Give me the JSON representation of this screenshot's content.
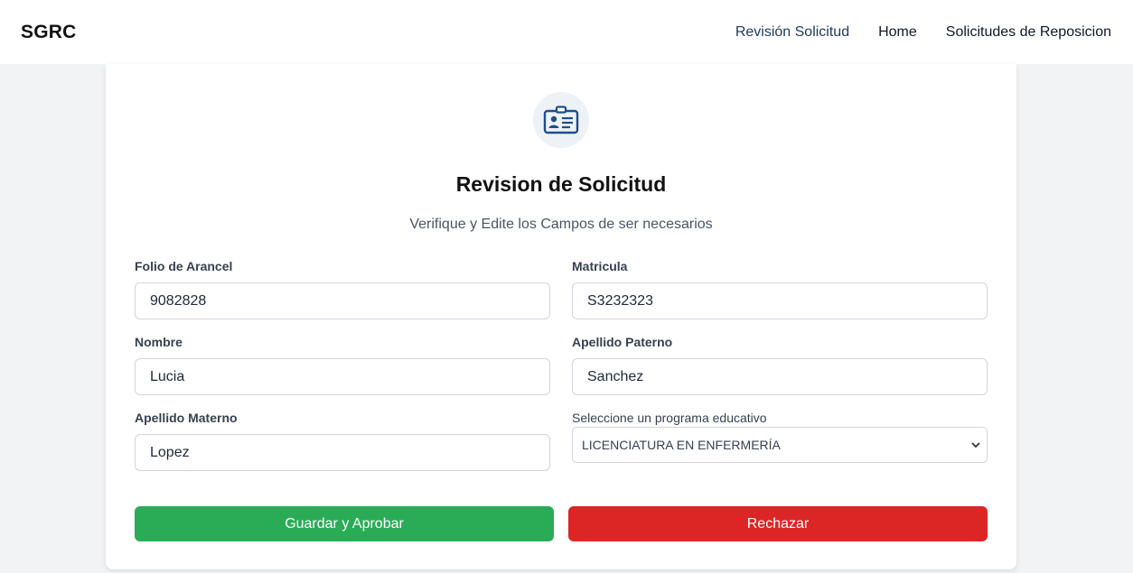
{
  "nav": {
    "brand": "SGRC",
    "links": [
      {
        "label": "Revisión Solicitud",
        "active": true
      },
      {
        "label": "Home",
        "active": false
      },
      {
        "label": "Solicitudes de Reposicion",
        "active": false
      }
    ]
  },
  "card": {
    "icon": "id-card-icon",
    "title": "Revision de Solicitud",
    "subtitle": "Verifique y Edite los Campos de ser necesarios"
  },
  "form": {
    "folio": {
      "label": "Folio de Arancel",
      "value": "9082828"
    },
    "matricula": {
      "label": "Matricula",
      "value": "S3232323"
    },
    "nombre": {
      "label": "Nombre",
      "value": "Lucia"
    },
    "apellido_paterno": {
      "label": "Apellido Paterno",
      "value": "Sanchez"
    },
    "apellido_materno": {
      "label": "Apellido Materno",
      "value": "Lopez"
    },
    "programa": {
      "label": "Seleccione un programa educativo",
      "selected": "LICENCIATURA EN ENFERMERÍA"
    }
  },
  "actions": {
    "approve_label": "Guardar y Aprobar",
    "reject_label": "Rechazar"
  },
  "colors": {
    "approve": "#2aac57",
    "reject": "#dc2626",
    "icon": "#1e4e8c"
  }
}
